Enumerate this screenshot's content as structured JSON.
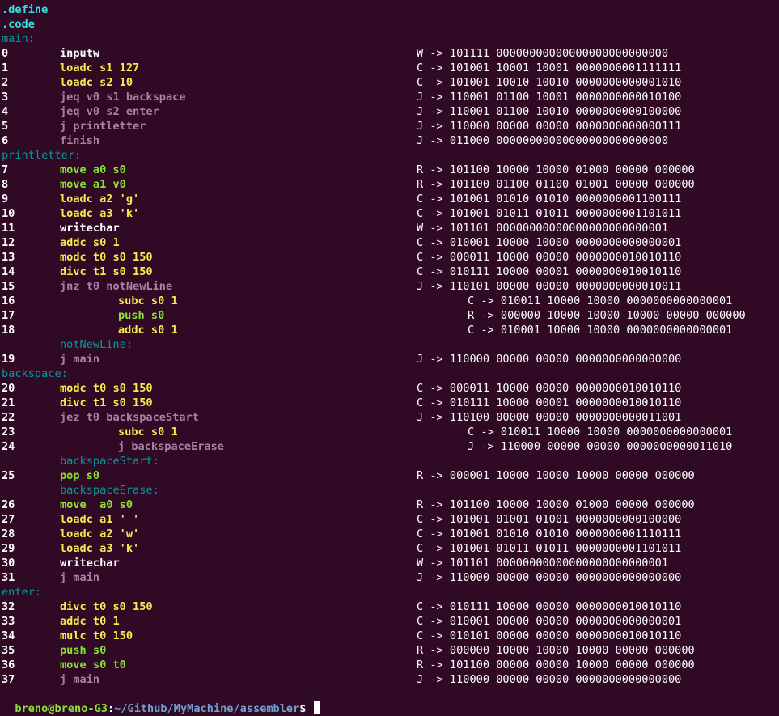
{
  "colors": {
    "background": "#300a24",
    "directive": "#34e2e2",
    "label": "#06989a",
    "io": "#ffffff",
    "load_arith": "#fce94f",
    "move_stack": "#8ae234",
    "jump_finish": "#ad7fa8",
    "prompt_user": "#8ae234",
    "prompt_path": "#729fcf"
  },
  "lines": [
    {
      "kind": "directive",
      "text": ".define"
    },
    {
      "kind": "directive",
      "text": ".code"
    },
    {
      "kind": "label",
      "text": "main:"
    },
    {
      "kind": "instr",
      "num": "0",
      "instr": "inputw",
      "color": "w",
      "out": "W -> 101111 00000000000000000000000000"
    },
    {
      "kind": "instr",
      "num": "1",
      "instr": "loadc s1 127",
      "color": "y",
      "out": "C -> 101001 10001 10001 0000000001111111"
    },
    {
      "kind": "instr",
      "num": "2",
      "instr": "loadc s2 10",
      "color": "y",
      "out": "C -> 101001 10010 10010 0000000000001010"
    },
    {
      "kind": "instr",
      "num": "3",
      "instr": "jeq v0 s1 backspace",
      "color": "p",
      "out": "J -> 110001 01100 10001 0000000000010100"
    },
    {
      "kind": "instr",
      "num": "4",
      "instr": "jeq v0 s2 enter",
      "color": "p",
      "out": "J -> 110001 01100 10010 0000000000100000"
    },
    {
      "kind": "instr",
      "num": "5",
      "instr": "j printletter",
      "color": "p",
      "out": "J -> 110000 00000 00000 0000000000000111"
    },
    {
      "kind": "instr",
      "num": "6",
      "instr": "finish",
      "color": "p",
      "out": "J -> 011000 00000000000000000000000000"
    },
    {
      "kind": "label",
      "text": "printletter:"
    },
    {
      "kind": "instr",
      "num": "7",
      "instr": "move a0 s0",
      "color": "g",
      "out": "R -> 101100 10000 10000 01000 00000 000000"
    },
    {
      "kind": "instr",
      "num": "8",
      "instr": "move a1 v0",
      "color": "g",
      "out": "R -> 101100 01100 01100 01001 00000 000000"
    },
    {
      "kind": "instr",
      "num": "9",
      "instr": "loadc a2 'g'",
      "color": "y",
      "out": "C -> 101001 01010 01010 0000000001100111"
    },
    {
      "kind": "instr",
      "num": "10",
      "instr": "loadc a3 'k'",
      "color": "y",
      "out": "C -> 101001 01011 01011 0000000001101011"
    },
    {
      "kind": "instr",
      "num": "11",
      "instr": "writechar",
      "color": "w",
      "out": "W -> 101101 00000000000000000000000001"
    },
    {
      "kind": "instr",
      "num": "12",
      "instr": "addc s0 1",
      "color": "y",
      "out": "C -> 010001 10000 10000 0000000000000001"
    },
    {
      "kind": "instr",
      "num": "13",
      "instr": "modc t0 s0 150",
      "color": "y",
      "out": "C -> 000011 10000 00000 0000000010010110"
    },
    {
      "kind": "instr",
      "num": "14",
      "instr": "divc t1 s0 150",
      "color": "y",
      "out": "C -> 010111 10000 00001 0000000010010110"
    },
    {
      "kind": "instr",
      "num": "15",
      "instr": "jnz t0 notNewLine",
      "color": "p",
      "out": "J -> 110101 00000 00000 0000000000010011"
    },
    {
      "kind": "instr",
      "num": "16",
      "instr": "subc s0 1",
      "color": "y",
      "indent": true,
      "out": "C -> 010011 10000 10000 0000000000000001"
    },
    {
      "kind": "instr",
      "num": "17",
      "instr": "push s0",
      "color": "g",
      "indent": true,
      "out": "R -> 000000 10000 10000 10000 00000 000000"
    },
    {
      "kind": "instr",
      "num": "18",
      "instr": "addc s0 1",
      "color": "y",
      "indent": true,
      "out": "C -> 010001 10000 10000 0000000000000001"
    },
    {
      "kind": "label",
      "text": "notNewLine:",
      "indent": true
    },
    {
      "kind": "instr",
      "num": "19",
      "instr": "j main",
      "color": "p",
      "out": "J -> 110000 00000 00000 0000000000000000"
    },
    {
      "kind": "label",
      "text": "backspace:"
    },
    {
      "kind": "instr",
      "num": "20",
      "instr": "modc t0 s0 150",
      "color": "y",
      "out": "C -> 000011 10000 00000 0000000010010110"
    },
    {
      "kind": "instr",
      "num": "21",
      "instr": "divc t1 s0 150",
      "color": "y",
      "out": "C -> 010111 10000 00001 0000000010010110"
    },
    {
      "kind": "instr",
      "num": "22",
      "instr": "jez t0 backspaceStart",
      "color": "p",
      "out": "J -> 110100 00000 00000 0000000000011001"
    },
    {
      "kind": "instr",
      "num": "23",
      "instr": "subc s0 1",
      "color": "y",
      "indent": true,
      "out": "C -> 010011 10000 10000 0000000000000001"
    },
    {
      "kind": "instr",
      "num": "24",
      "instr": "j backspaceErase",
      "color": "p",
      "indent": true,
      "out": "J -> 110000 00000 00000 0000000000011010"
    },
    {
      "kind": "label",
      "text": "backspaceStart:",
      "indent": true
    },
    {
      "kind": "instr",
      "num": "25",
      "instr": "pop s0",
      "color": "g",
      "out": "R -> 000001 10000 10000 10000 00000 000000"
    },
    {
      "kind": "label",
      "text": "backspaceErase:",
      "indent": true
    },
    {
      "kind": "instr",
      "num": "26",
      "instr": "move  a0 s0",
      "color": "g",
      "out": "R -> 101100 10000 10000 01000 00000 000000"
    },
    {
      "kind": "instr",
      "num": "27",
      "instr": "loadc a1 ' '",
      "color": "y",
      "out": "C -> 101001 01001 01001 0000000000100000"
    },
    {
      "kind": "instr",
      "num": "28",
      "instr": "loadc a2 'w'",
      "color": "y",
      "out": "C -> 101001 01010 01010 0000000001110111"
    },
    {
      "kind": "instr",
      "num": "29",
      "instr": "loadc a3 'k'",
      "color": "y",
      "out": "C -> 101001 01011 01011 0000000001101011"
    },
    {
      "kind": "instr",
      "num": "30",
      "instr": "writechar",
      "color": "w",
      "out": "W -> 101101 00000000000000000000000001"
    },
    {
      "kind": "instr",
      "num": "31",
      "instr": "j main",
      "color": "p",
      "out": "J -> 110000 00000 00000 0000000000000000"
    },
    {
      "kind": "label",
      "text": "enter:"
    },
    {
      "kind": "instr",
      "num": "32",
      "instr": "divc t0 s0 150",
      "color": "y",
      "out": "C -> 010111 10000 00000 0000000010010110"
    },
    {
      "kind": "instr",
      "num": "33",
      "instr": "addc t0 1",
      "color": "y",
      "out": "C -> 010001 00000 00000 0000000000000001"
    },
    {
      "kind": "instr",
      "num": "34",
      "instr": "mulc t0 150",
      "color": "y",
      "out": "C -> 010101 00000 00000 0000000010010110"
    },
    {
      "kind": "instr",
      "num": "35",
      "instr": "push s0",
      "color": "g",
      "out": "R -> 000000 10000 10000 10000 00000 000000"
    },
    {
      "kind": "instr",
      "num": "36",
      "instr": "move s0 t0",
      "color": "g",
      "out": "R -> 101100 00000 00000 10000 00000 000000"
    },
    {
      "kind": "instr",
      "num": "37",
      "instr": "j main",
      "color": "p",
      "out": "J -> 110000 00000 00000 0000000000000000"
    }
  ],
  "prompt": {
    "user": "breno@breno-G3",
    "separator": ":",
    "path": "~/Github/MyMachine/assembler",
    "symbol": "$ "
  }
}
